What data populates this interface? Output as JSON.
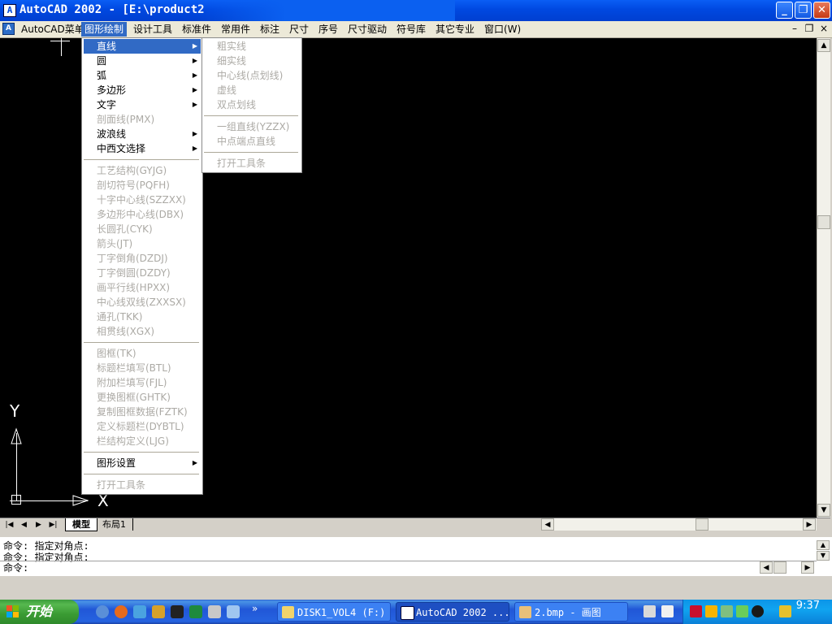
{
  "window": {
    "title": "AutoCAD 2002 - [E:\\product2",
    "icon_letter": "A",
    "minimize_glyph": "_",
    "restore_glyph": "❐",
    "close_glyph": "✕"
  },
  "menubar": {
    "items": [
      "AutoCAD菜单",
      "图形绘制",
      "设计工具",
      "标准件",
      "常用件",
      "标注",
      "尺寸",
      "序号",
      "尺寸驱动",
      "符号库",
      "其它专业",
      "窗口(W)"
    ],
    "active_index": 1,
    "mdi_minimize": "–",
    "mdi_restore": "❐",
    "mdi_close": "×"
  },
  "main_menu": {
    "items": [
      {
        "label": "直线",
        "submenu": true,
        "enabled": true,
        "highlighted": true
      },
      {
        "label": "圆",
        "submenu": true,
        "enabled": true
      },
      {
        "label": "弧",
        "submenu": true,
        "enabled": true
      },
      {
        "label": "多边形",
        "submenu": true,
        "enabled": true
      },
      {
        "label": "文字",
        "submenu": true,
        "enabled": true
      },
      {
        "label": "剖面线(PMX)",
        "submenu": false,
        "enabled": false
      },
      {
        "label": "波浪线",
        "submenu": true,
        "enabled": true
      },
      {
        "label": "中西文选择",
        "submenu": true,
        "enabled": true
      },
      {
        "separator": true
      },
      {
        "label": "工艺结构(GYJG)",
        "enabled": false
      },
      {
        "label": "剖切符号(PQFH)",
        "enabled": false
      },
      {
        "label": "十字中心线(SZZXX)",
        "enabled": false
      },
      {
        "label": "多边形中心线(DBX)",
        "enabled": false
      },
      {
        "label": "长圆孔(CYK)",
        "enabled": false
      },
      {
        "label": "箭头(JT)",
        "enabled": false
      },
      {
        "label": "丁字倒角(DZDJ)",
        "enabled": false
      },
      {
        "label": "丁字倒圆(DZDY)",
        "enabled": false
      },
      {
        "label": "画平行线(HPXX)",
        "enabled": false
      },
      {
        "label": "中心线双线(ZXXSX)",
        "enabled": false
      },
      {
        "label": "通孔(TKK)",
        "enabled": false
      },
      {
        "label": "相贯线(XGX)",
        "enabled": false
      },
      {
        "separator": true
      },
      {
        "label": "图框(TK)",
        "enabled": false
      },
      {
        "label": "标题栏填写(BTL)",
        "enabled": false
      },
      {
        "label": "附加栏填写(FJL)",
        "enabled": false
      },
      {
        "label": "更换图框(GHTK)",
        "enabled": false
      },
      {
        "label": "复制图框数据(FZTK)",
        "enabled": false
      },
      {
        "label": "定义标题栏(DYBTL)",
        "enabled": false
      },
      {
        "label": "栏结构定义(LJG)",
        "enabled": false
      },
      {
        "separator": true
      },
      {
        "label": "图形设置",
        "submenu": true,
        "enabled": true
      },
      {
        "separator": true
      },
      {
        "label": "打开工具条",
        "enabled": false
      }
    ]
  },
  "sub_menu": {
    "items": [
      {
        "label": "粗实线",
        "enabled": false
      },
      {
        "label": "细实线",
        "enabled": false
      },
      {
        "label": "中心线(点划线)",
        "enabled": false
      },
      {
        "label": "虚线",
        "enabled": false
      },
      {
        "label": "双点划线",
        "enabled": false
      },
      {
        "separator": true
      },
      {
        "label": "一组直线(YZZX)",
        "enabled": false
      },
      {
        "label": "中点端点直线",
        "enabled": false
      },
      {
        "separator": true
      },
      {
        "label": "打开工具条",
        "enabled": false
      }
    ]
  },
  "drawing": {
    "ucs_y": "Y",
    "ucs_x": "X",
    "background": "#000000"
  },
  "layout_tabs": {
    "nav": [
      "|◀",
      "◀",
      "▶",
      "▶|"
    ],
    "tabs": [
      "模型",
      "布局1"
    ],
    "active_index": 0
  },
  "command": {
    "history": [
      "命令: 指定对角点:",
      "命令: 指定对角点:"
    ],
    "prompt": "命令:"
  },
  "taskbar": {
    "start_label": "开始",
    "tasks": [
      {
        "label": "DISK1_VOL4 (F:)",
        "active": false
      },
      {
        "label": "AutoCAD 2002 ...",
        "active": true
      },
      {
        "label": "2.bmp - 画图",
        "active": false
      }
    ],
    "clock": "9:37",
    "more_glyph": "»"
  },
  "colors": {
    "titlebar": "#0048e0",
    "menu_highlight": "#316ac5",
    "disabled_text": "#acaaa5",
    "taskbar": "#2157d7",
    "start_green": "#3a9b33"
  }
}
